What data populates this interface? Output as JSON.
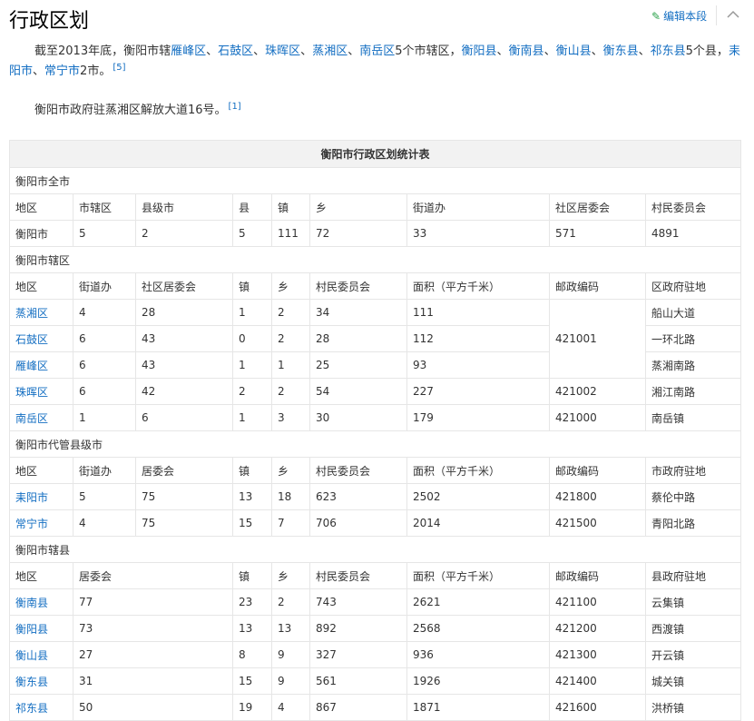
{
  "section": {
    "title": "行政区划",
    "edit_label": "编辑本段"
  },
  "para1": {
    "text": [
      {
        "t": "截至2013年底，衡阳市辖"
      },
      {
        "t": "雁峰区",
        "link": true
      },
      {
        "t": "、"
      },
      {
        "t": "石鼓区",
        "link": true
      },
      {
        "t": "、"
      },
      {
        "t": "珠晖区",
        "link": true
      },
      {
        "t": "、"
      },
      {
        "t": "蒸湘区",
        "link": true
      },
      {
        "t": "、"
      },
      {
        "t": "南岳区",
        "link": true
      },
      {
        "t": "5个市辖区，"
      },
      {
        "t": "衡阳县",
        "link": true
      },
      {
        "t": "、"
      },
      {
        "t": "衡南县",
        "link": true
      },
      {
        "t": "、"
      },
      {
        "t": "衡山县",
        "link": true
      },
      {
        "t": "、"
      },
      {
        "t": "衡东县",
        "link": true
      },
      {
        "t": "、"
      },
      {
        "t": "祁东县",
        "link": true
      },
      {
        "t": "5个县，"
      },
      {
        "t": "耒阳市",
        "link": true
      },
      {
        "t": "、"
      },
      {
        "t": "常宁市",
        "link": true
      },
      {
        "t": "2市。"
      }
    ],
    "ref": "[5]"
  },
  "para2": {
    "text": "衡阳市政府驻蒸湘区解放大道16号。",
    "ref": "[1]"
  },
  "table": {
    "caption": "衡阳市行政区划统计表",
    "sections": [
      {
        "title": "衡阳市全市",
        "header": [
          "地区",
          "市辖区",
          "县级市",
          "县",
          "镇",
          "乡",
          "街道办",
          "社区居委会",
          "村民委员会"
        ],
        "rows": [
          [
            "衡阳市",
            "5",
            "2",
            "5",
            "111",
            "72",
            "33",
            "571",
            "4891"
          ]
        ]
      },
      {
        "title": "衡阳市辖区",
        "header": [
          "地区",
          "街道办",
          "社区居委会",
          "镇",
          "乡",
          "村民委员会",
          "面积（平方千米）",
          "邮政编码",
          "区政府驻地"
        ],
        "rows": [
          [
            "蒸湘区",
            "4",
            "28",
            "1",
            "2",
            "34",
            "111",
            "421001",
            "船山大道"
          ],
          [
            "石鼓区",
            "6",
            "43",
            "0",
            "2",
            "28",
            "112",
            "",
            "一环北路"
          ],
          [
            "雁峰区",
            "6",
            "43",
            "1",
            "1",
            "25",
            "93",
            "",
            "蒸湘南路"
          ],
          [
            "珠晖区",
            "6",
            "42",
            "2",
            "2",
            "54",
            "227",
            "421002",
            "湘江南路"
          ],
          [
            "南岳区",
            "1",
            "6",
            "1",
            "3",
            "30",
            "179",
            "421000",
            "南岳镇"
          ]
        ]
      },
      {
        "title": "衡阳市代管县级市",
        "header": [
          "地区",
          "街道办",
          "居委会",
          "镇",
          "乡",
          "村民委员会",
          "面积（平方千米）",
          "邮政编码",
          "市政府驻地"
        ],
        "rows": [
          [
            "耒阳市",
            "5",
            "75",
            "13",
            "18",
            "623",
            "2502",
            "421800",
            "蔡伦中路"
          ],
          [
            "常宁市",
            "4",
            "75",
            "15",
            "7",
            "706",
            "2014",
            "421500",
            "青阳北路"
          ]
        ]
      },
      {
        "title": "衡阳市辖县",
        "header": [
          "地区",
          "居委会",
          "镇",
          "乡",
          "村民委员会",
          "面积（平方千米）",
          "邮政编码",
          "县政府驻地"
        ],
        "rows": [
          [
            "衡南县",
            "77",
            "23",
            "2",
            "743",
            "2621",
            "421100",
            "云集镇"
          ],
          [
            "衡阳县",
            "73",
            "13",
            "13",
            "892",
            "2568",
            "421200",
            "西渡镇"
          ],
          [
            "衡山县",
            "27",
            "8",
            "9",
            "327",
            "936",
            "421300",
            "开云镇"
          ],
          [
            "衡东县",
            "31",
            "15",
            "9",
            "561",
            "1926",
            "421400",
            "城关镇"
          ],
          [
            "祁东县",
            "50",
            "19",
            "4",
            "867",
            "1871",
            "421600",
            "洪桥镇"
          ]
        ]
      }
    ]
  }
}
